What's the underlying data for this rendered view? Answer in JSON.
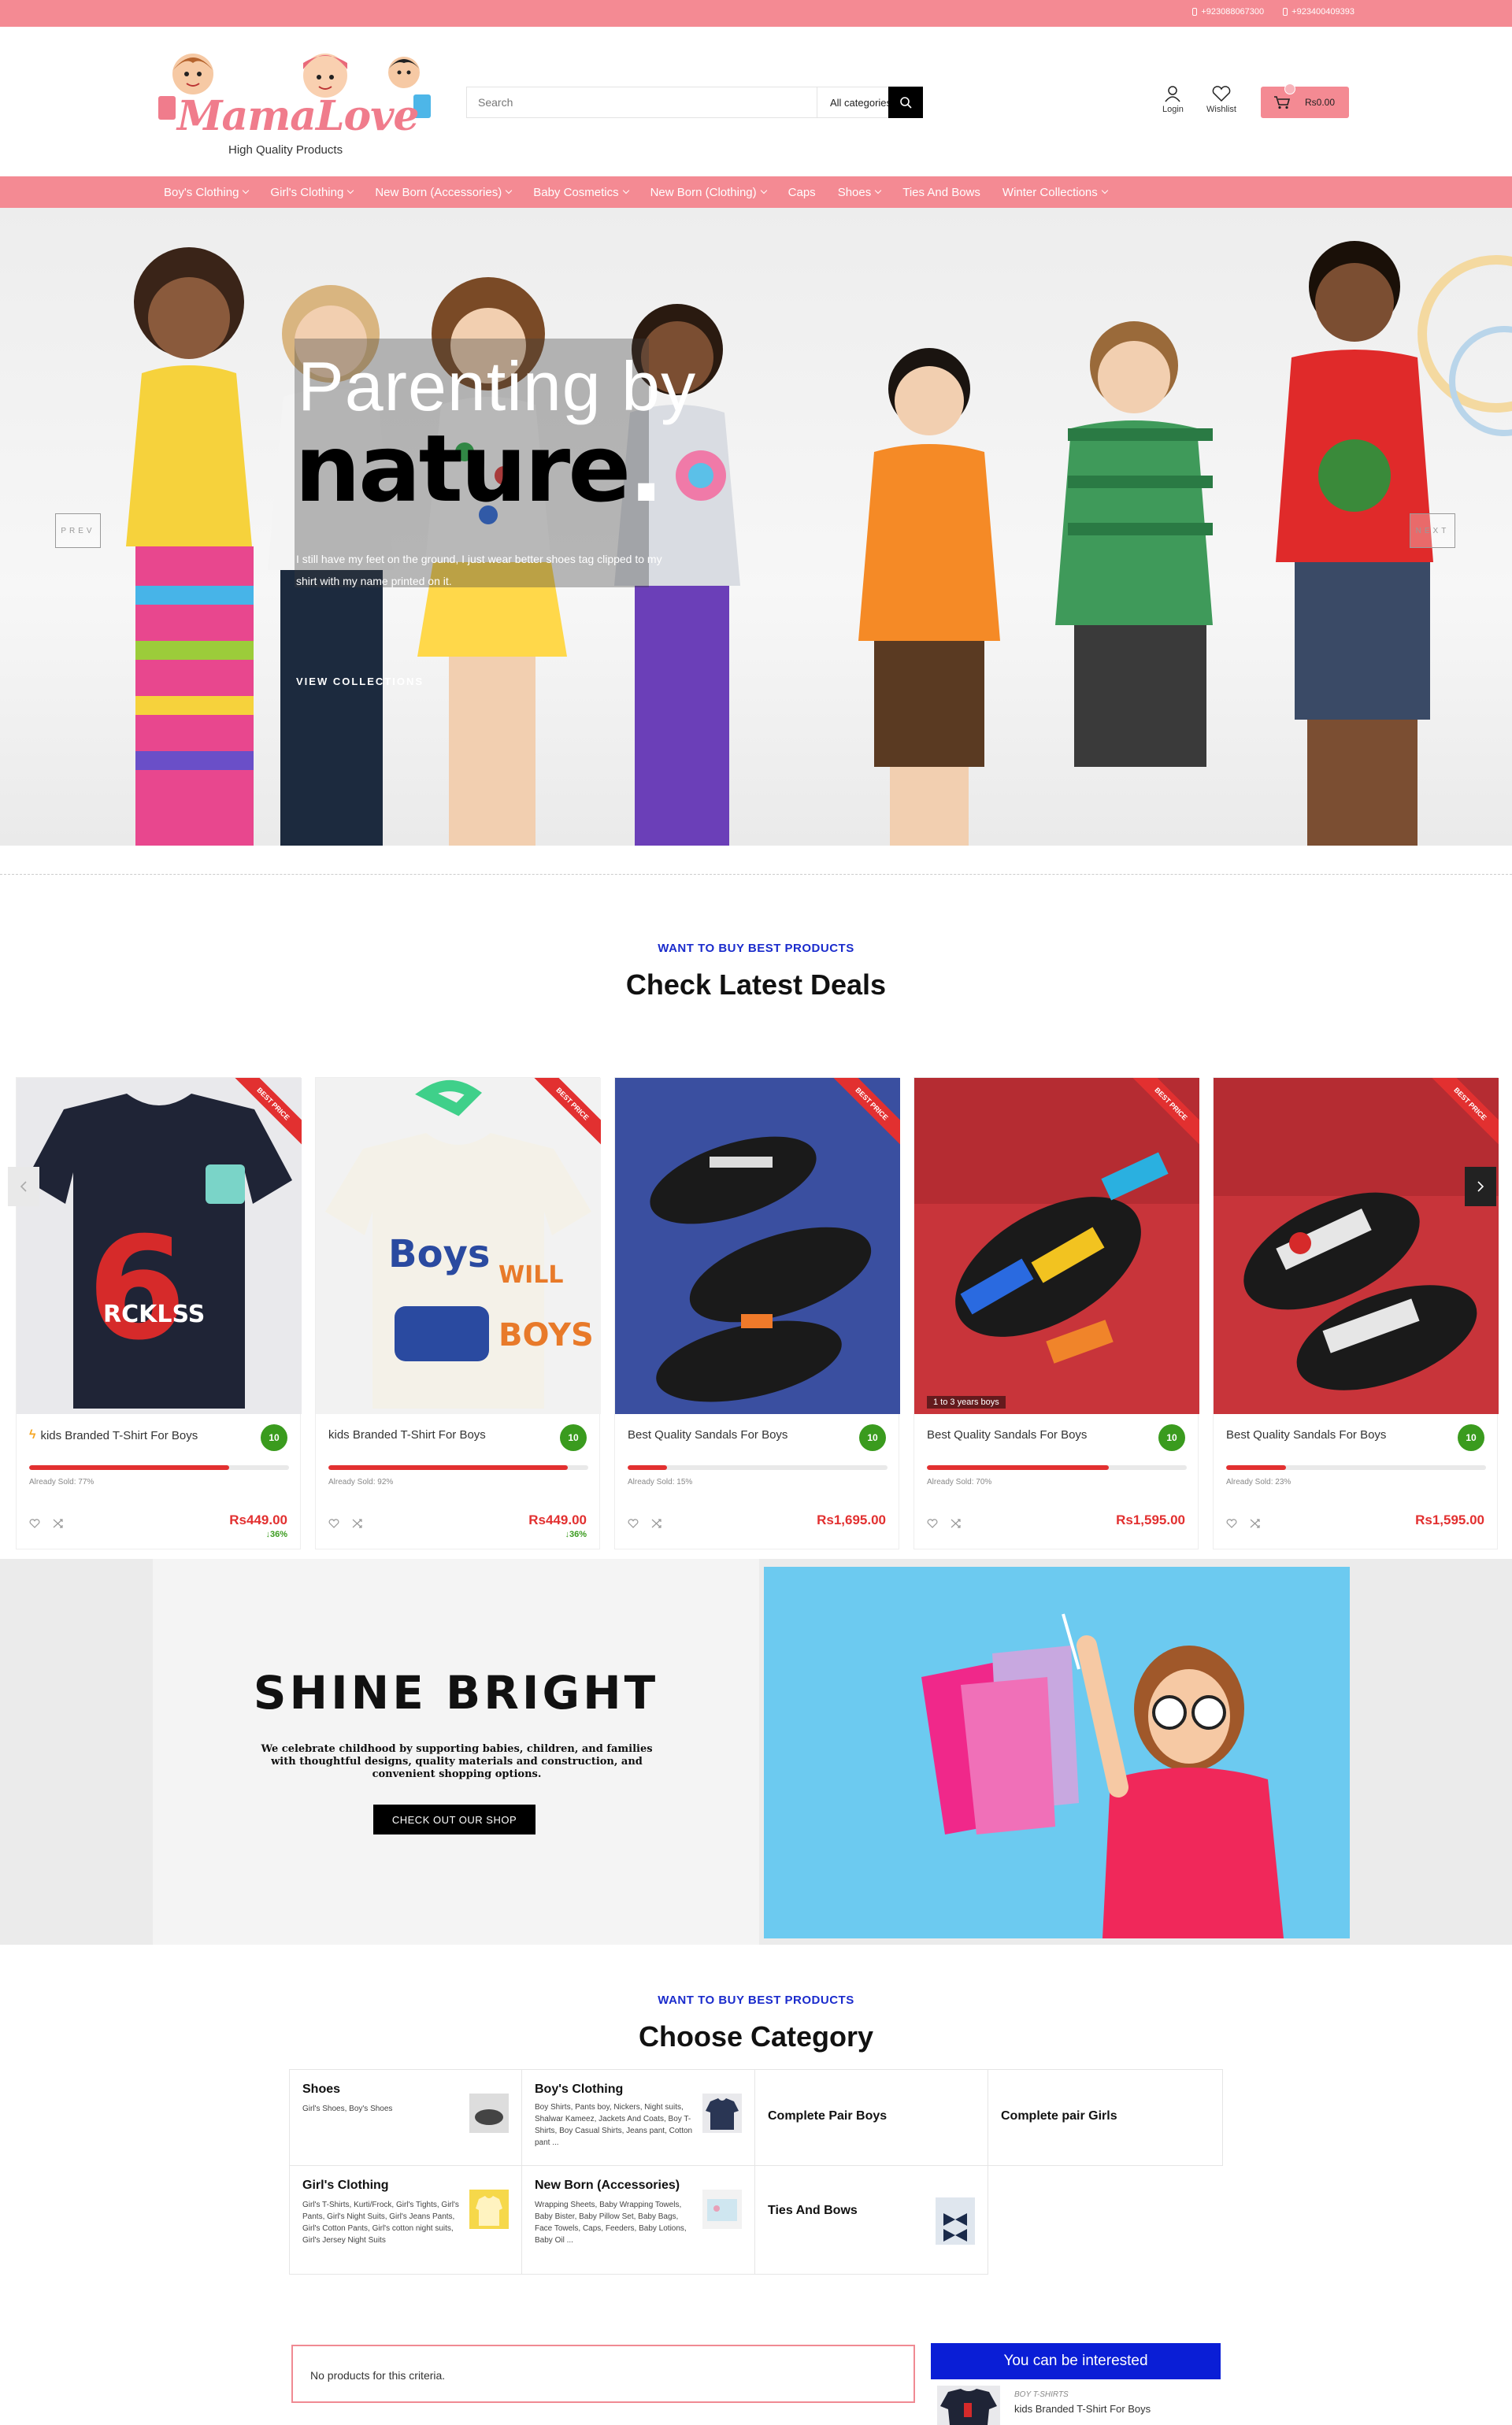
{
  "topbar": {
    "phones": [
      "+923088067300",
      "+923400409393"
    ]
  },
  "header": {
    "logo_text": "MamaLove",
    "logo_tagline": "High Quality Products",
    "search_placeholder": "Search",
    "category_select": "All categories",
    "login_label": "Login",
    "wishlist_label": "Wishlist",
    "cart_total": "Rs0.00"
  },
  "nav": {
    "items": [
      {
        "label": "Boy's Clothing",
        "dropdown": true
      },
      {
        "label": "Girl's Clothing",
        "dropdown": true
      },
      {
        "label": "New Born (Accessories)",
        "dropdown": true
      },
      {
        "label": "Baby Cosmetics",
        "dropdown": true
      },
      {
        "label": "New Born (Clothing)",
        "dropdown": true
      },
      {
        "label": "Caps",
        "dropdown": false
      },
      {
        "label": "Shoes",
        "dropdown": true
      },
      {
        "label": "Ties And Bows",
        "dropdown": false
      },
      {
        "label": "Winter Collections",
        "dropdown": true
      }
    ]
  },
  "hero": {
    "title_line1": "Parenting by",
    "title_line2": "nature",
    "subtitle": "I still have my feet on the ground, I just wear better shoes tag clipped to my shirt with my name printed on it.",
    "cta": "VIEW COLLECTIONS",
    "prev": "PREV",
    "next": "NEXT"
  },
  "deals": {
    "eyebrow": "WANT TO BUY BEST PRODUCTS",
    "title": "Check Latest Deals",
    "ribbon": "BEST PRICE",
    "products": [
      {
        "name": "kids Branded T-Shirt For Boys",
        "count": "10",
        "sold_label": "Already Sold: 77%",
        "sold": 77,
        "price": "Rs449.00",
        "discount": "36%",
        "bolt": true
      },
      {
        "name": "kids Branded T-Shirt For Boys",
        "count": "10",
        "sold_label": "Already Sold: 92%",
        "sold": 92,
        "price": "Rs449.00",
        "discount": "36%",
        "bolt": false
      },
      {
        "name": "Best Quality Sandals For Boys",
        "count": "10",
        "sold_label": "Already Sold: 15%",
        "sold": 15,
        "price": "Rs1,695.00",
        "discount": "",
        "bolt": false
      },
      {
        "name": "Best Quality Sandals For Boys",
        "count": "10",
        "sold_label": "Already Sold: 70%",
        "sold": 70,
        "price": "Rs1,595.00",
        "discount": "",
        "bolt": false,
        "caption": "1 to 3 years boys"
      },
      {
        "name": "Best Quality Sandals For Boys",
        "count": "10",
        "sold_label": "Already Sold: 23%",
        "sold": 23,
        "price": "Rs1,595.00",
        "discount": "",
        "bolt": false
      }
    ]
  },
  "banner": {
    "title": "SHINE BRIGHT",
    "text": "We celebrate childhood by supporting babies, children, and families with thoughtful designs, quality materials and construction, and convenient shopping options.",
    "cta": "CHECK OUT OUR SHOP"
  },
  "categories": {
    "eyebrow": "WANT TO BUY BEST PRODUCTS",
    "title": "Choose Category",
    "items": [
      {
        "name": "Shoes",
        "sub": "Girl's Shoes, Boy's Shoes"
      },
      {
        "name": "Boy's Clothing",
        "sub": "Boy Shirts, Pants boy, Nickers, Night suits, Shalwar Kameez, Jackets And Coats, Boy T-Shirts, Boy Casual Shirts, Jeans pant, Cotton pant ..."
      },
      {
        "name": "Complete Pair Boys",
        "sub": ""
      },
      {
        "name": "Complete pair Girls",
        "sub": ""
      },
      {
        "name": "Girl's Clothing",
        "sub": "Girl's T-Shirts, Kurti/Frock, Girl's Tights, Girl's Pants, Girl's Night Suits, Girl's Jeans Pants, Girl's Cotton Pants, Girl's cotton night suits, Girl's Jersey Night Suits"
      },
      {
        "name": "New Born (Accessories)",
        "sub": "Wrapping Sheets, Baby Wrapping Towels, Baby Bister, Baby Pillow Set, Baby Bags, Face Towels, Caps, Feeders, Baby Lotions, Baby Oil ..."
      },
      {
        "name": "Ties And Bows",
        "sub": ""
      }
    ]
  },
  "bottom": {
    "no_products": "No products for this criteria.",
    "interested_title": "You can be interested",
    "side_category": "BOY T-SHIRTS",
    "side_name": "kids Branded T-Shirt For Boys"
  },
  "colors": {
    "brand_pink": "#f48a93",
    "accent_blue": "#0a1ed6",
    "sale_red": "#e23030",
    "badge_green": "#3a9b1e"
  }
}
